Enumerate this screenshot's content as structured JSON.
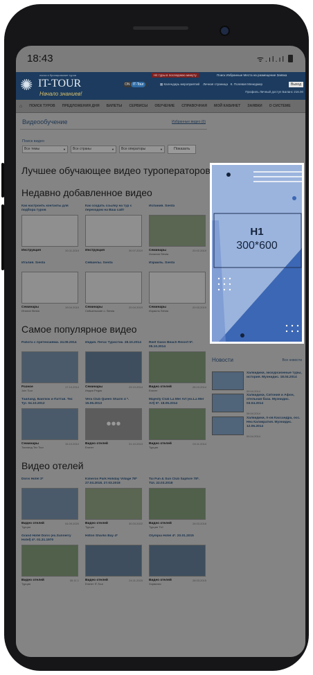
{
  "status_bar": {
    "time": "18:43",
    "icons": "ᯤ.ıl.ıl"
  },
  "site": {
    "logo": "IT-TOUR",
    "logo_tagline": "поиск и бронирование туров",
    "logo_sub": "Начало знаниев!",
    "hot_label": "Hit туры в последнюю минуту",
    "top_links": "Поиск  Избранные  Места на размещение  Заявка",
    "toggle": {
      "left": "ON",
      "right": "IT-Tour"
    },
    "header_mid": "Календарь мероприятий",
    "header_mid2": "Личная страница",
    "header_manager": "К. Полевая Менеджер",
    "logout": "Выход",
    "header_row2": "Профиль   Личный доступ   Баланс 216.00",
    "nav": [
      "ПОИСК ТУРОВ",
      "ПРЕДЛОЖЕНИЯ ДНЯ",
      "БИЛЕТЫ",
      "СЕРВИСЫ",
      "ОБУЧЕНИЕ",
      "СПРАВОЧНАЯ",
      "МОЙ КАБИНЕТ",
      "ЗАЯВКИ",
      "О СИСТЕМЕ"
    ]
  },
  "page": {
    "title": "Видеообучение",
    "favorites": "Избранные видео (0)",
    "search_label": "Поиск видео",
    "filters": [
      "Все темы",
      "Все страны",
      "Все операторы"
    ],
    "show_button": "Показать",
    "best_heading": "Лучшее обучающее видео туроператоров",
    "recent_heading": "Недавно добавленное видео",
    "popular_heading": "Самое популярное видео",
    "hotel_heading": "Видео отелей"
  },
  "recent": [
    {
      "title": "Как настроить контакты для подбора туров",
      "cat": "Инструкция",
      "date": "20.11.2019",
      "sub": ""
    },
    {
      "title": "Как создать ссылку на тур с переходом на Ваш сайт",
      "cat": "Инструкция",
      "date": "30.07.2019",
      "sub": ""
    },
    {
      "title": "Испания. Siesta",
      "cat": "Семинары",
      "date": "20.02.2019",
      "sub": "Испания Siesta"
    },
    {
      "title": "Италия. Siesta",
      "cat": "Семинары",
      "date": "19.04.2019",
      "sub": "Италия Siesta"
    },
    {
      "title": "Сейшелы. Siesta",
      "cat": "Семинары",
      "date": "20.04.2019",
      "sub": "Сейшельские о. Siesta"
    },
    {
      "title": "Израиль. Siesta",
      "cat": "Семинары",
      "date": "20.03.2019",
      "sub": "Израиль Siesta"
    }
  ],
  "popular": [
    {
      "title": "Работа с претензиями. 24.09.2014",
      "cat": "Разное",
      "date": "17.10.2014",
      "sub": "Join Tour"
    },
    {
      "title": "Индия. Пегас Туристик. 28.10.2014",
      "cat": "Семинары",
      "date": "29.10.2014",
      "sub": "Индия Pegas"
    },
    {
      "title": "Reef Oasis Beach Resort 5*. 05.10.2014",
      "cat": "Видео отелей",
      "date": "28.10.2014",
      "sub": "Египет"
    },
    {
      "title": "Таиланд. Бангкок и Паттая. Tez Tyr. 04.10.2012",
      "cat": "Семинары",
      "date": "15.10.2012",
      "sub": "Таиланд Tez Tour"
    },
    {
      "title": "Vera Club Queen Sharm 4 *. 15.06.2013",
      "cat": "Видео отелей",
      "date": "31.10.2013",
      "sub": "Египет"
    },
    {
      "title": "Majesty Club La Mer Art (ex.La Mer Art) 5*. 18.05.2014",
      "cat": "Видео отелей",
      "date": "03.11.2014",
      "sub": "Турция"
    }
  ],
  "hotels": [
    {
      "title": "Doris Hotel 3*",
      "cat": "Видео отелей",
      "date": "04.09.2020",
      "sub": "Турция"
    },
    {
      "title": "Kimeros Park Holiday Village 78* 27.03.2018. 27.03.2018",
      "cat": "Видео отелей",
      "date": "30.03.2022",
      "sub": "Турция"
    },
    {
      "title": "Tui Fun & Sun Club Saphire 78*. TUI. 22.03.2018",
      "cat": "Видео отелей",
      "date": "28.03.2018",
      "sub": "Турция TUI"
    },
    {
      "title": "Grand Hotel Doris (ex.Sunnerry Hotel) 4*. 01.31.1970",
      "cat": "Видео отелей",
      "date": "05.11.1",
      "sub": "Турция"
    },
    {
      "title": "Hilton Sharks Bay 4*",
      "cat": "Видео отелей",
      "date": "24.11.2015",
      "sub": "Египет IT-Tour"
    },
    {
      "title": "Olympia Hotel 4*. 20.01.2015",
      "cat": "Видео отелей",
      "date": "28.03.2015",
      "sub": "Хорватия"
    }
  ],
  "ad": {
    "h1": "H1",
    "size": "300*600"
  },
  "news": {
    "heading": "Новости",
    "all": "Все новости",
    "items": [
      {
        "title": "Халкидики, экскурсионные туры, история. Муэнидис. 18.04.2014",
        "date": "09.04.2014"
      },
      {
        "title": "Халкидики, Ситония и Афон, отельная база. Муэнидис. 03.04.2014",
        "date": "08.04.2014"
      },
      {
        "title": "Халкидики, п-ов Кассандра, осс. Неа Каликратия. Муэнидис. 12.06.2014",
        "date": "09.04.2014"
      }
    ]
  }
}
